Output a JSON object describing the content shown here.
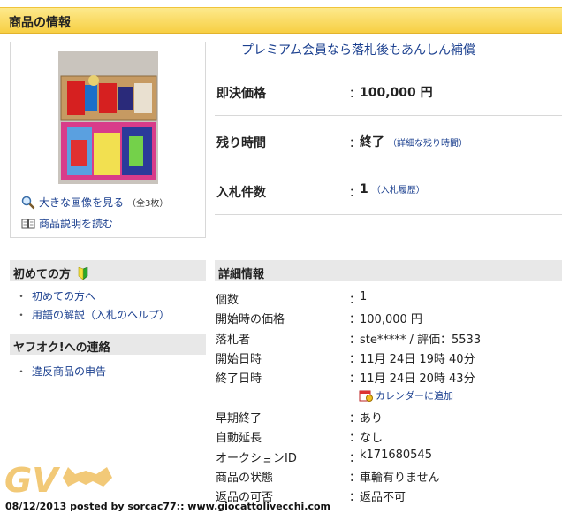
{
  "header": {
    "title": "商品の情報"
  },
  "image_panel": {
    "view_large_label": "大きな画像を見る",
    "image_count": "（全3枚）",
    "read_description_label": "商品説明を読む"
  },
  "premium": {
    "text": "プレミアム会員なら落札後もあんしん補償"
  },
  "summary": {
    "buyout": {
      "label": "即決価格",
      "colon": "：",
      "value": "100,000 円"
    },
    "remaining": {
      "label": "残り時間",
      "colon": "：",
      "value": "終了",
      "link": "（詳細な残り時間）"
    },
    "bids": {
      "label": "入札件数",
      "colon": "：",
      "value": "1",
      "link": "（入札履歴）"
    }
  },
  "sidebar": {
    "beginners": {
      "title": "初めての方",
      "items": [
        "初めての方へ",
        "用語の解説（入札のヘルプ）"
      ]
    },
    "contact": {
      "title": "ヤフオク!への連絡",
      "items": [
        "違反商品の申告"
      ]
    },
    "bullet": "・"
  },
  "details": {
    "title": "詳細情報",
    "rows": [
      {
        "label": "個数",
        "value": "1"
      },
      {
        "label": "開始時の価格",
        "value": "100,000 円"
      },
      {
        "label": "落札者",
        "value": "ste***** / 評価：5533"
      },
      {
        "label": "開始日時",
        "value": "11月 24日 19時 40分"
      },
      {
        "label": "終了日時",
        "value": "11月 24日 20時 43分"
      },
      {
        "label": "早期終了",
        "value": "あり"
      },
      {
        "label": "自動延長",
        "value": "なし"
      },
      {
        "label": "オークションID",
        "value": "k171680545"
      },
      {
        "label": "商品の状態",
        "value": "車輪有りません"
      },
      {
        "label": "返品の可否",
        "value": "返品不可"
      }
    ],
    "colon": "：",
    "calendar_link": "カレンダーに追加"
  },
  "watermark": {
    "logo": "GV"
  },
  "footer": {
    "text": "08/12/2013 posted by sorcac77:: www.giocattolivecchi.com"
  },
  "colors": {
    "header_bg": "#f7cf43",
    "link": "#1a3f8f",
    "section_bg": "#e8e8e8"
  }
}
